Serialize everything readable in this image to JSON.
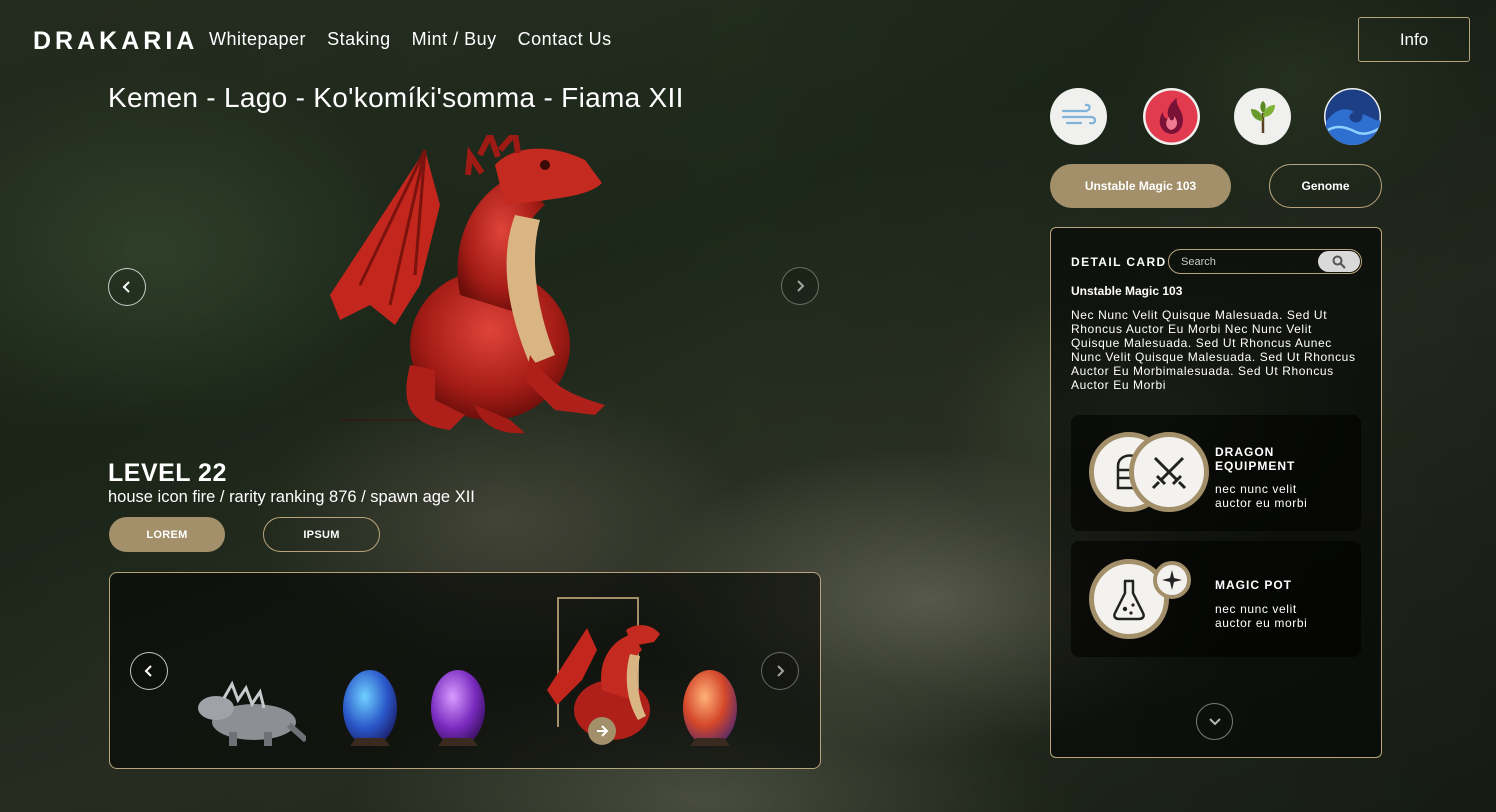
{
  "nav": {
    "brand": "DRAKARIA",
    "links": [
      "Whitepaper",
      "Staking",
      "Mint / Buy",
      "Contact Us"
    ],
    "info_button": "Info"
  },
  "hero": {
    "title": "Kemen - Lago - Ko'komíki'somma - Fiama XII",
    "level": "LEVEL 22",
    "subtitle": "house icon fire / rarity ranking 876 / spawn age XII",
    "button_primary": "LOREM",
    "button_secondary": "IPSUM"
  },
  "elements": [
    "wind-icon",
    "fire-icon",
    "plant-icon",
    "water-icon"
  ],
  "tabs": {
    "active": "Unstable Magic 103",
    "other": "Genome"
  },
  "detail_card": {
    "heading": "DETAIL CARD",
    "search_placeholder": "Search",
    "subheading": "Unstable Magic 103",
    "body": "Nec Nunc Velit Quisque Malesuada. Sed Ut Rhoncus Auctor Eu Morbi Nec Nunc Velit Quisque Malesuada. Sed Ut Rhoncus Aunec Nunc Velit Quisque Malesuada. Sed Ut Rhoncus Auctor Eu Morbimalesuada. Sed Ut Rhoncus Auctor Eu Morbi",
    "features": [
      {
        "title": "DRAGON EQUIPMENT",
        "text": "nec nunc velit auctor eu morbi"
      },
      {
        "title": "MAGIC POT",
        "text": "nec nunc velit auctor eu morbi"
      }
    ]
  },
  "carousel": {
    "items": [
      "grey-dragon",
      "blue-egg",
      "purple-egg",
      "red-dragon",
      "orange-egg"
    ],
    "selected": "red-dragon"
  },
  "colors": {
    "accent": "#a3906a",
    "border": "#b8a47c"
  }
}
